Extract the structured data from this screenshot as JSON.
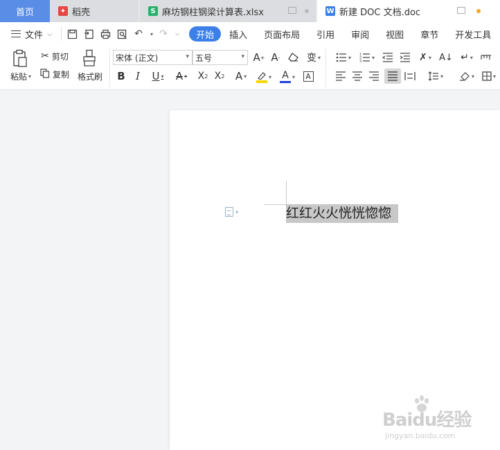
{
  "tabs": [
    {
      "label": "首页"
    },
    {
      "label": "稻壳"
    },
    {
      "label": "麻坊钢柱钢梁计算表.xlsx"
    },
    {
      "label": "新建 DOC 文档.doc"
    }
  ],
  "menu": {
    "file_label": "文件",
    "tabs": [
      "开始",
      "插入",
      "页面布局",
      "引用",
      "审阅",
      "视图",
      "章节",
      "开发工具"
    ],
    "active_tab": "开始"
  },
  "ribbon": {
    "paste_label": "粘贴",
    "cut_label": "剪切",
    "copy_label": "复制",
    "format_painter_label": "格式刷",
    "font_name": "宋体 (正文)",
    "font_size": "五号",
    "colors": {
      "highlight": "#f5d800",
      "font_color": "#1f3fd6",
      "accent": "#3d7fe8"
    }
  },
  "document": {
    "text": "红红火火恍恍惚惚"
  },
  "watermark": {
    "brand": "Baidu经验",
    "url": "jingyan.baidu.com"
  }
}
